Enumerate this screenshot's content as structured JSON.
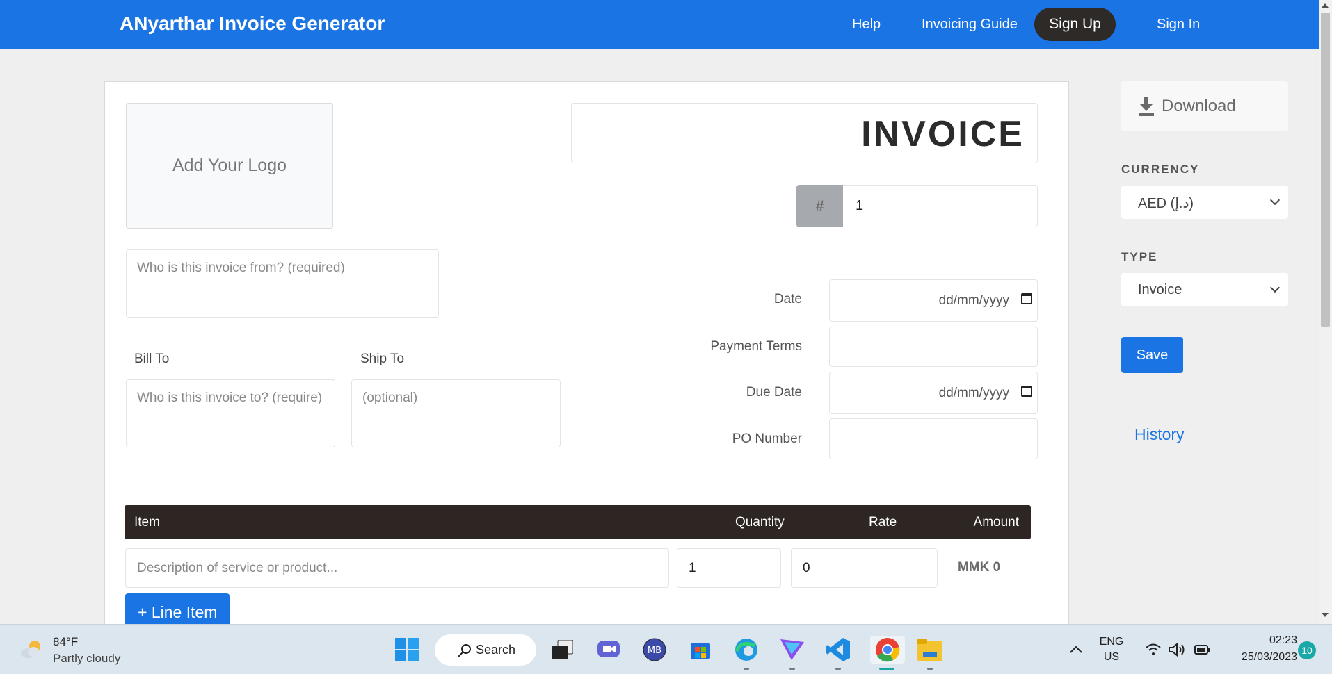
{
  "navbar": {
    "brand": "ANyarthar Invoice Generator",
    "help": "Help",
    "guide": "Invoicing Guide",
    "signup": "Sign Up",
    "signin": "Sign In",
    "color": "#1b74e4"
  },
  "invoice": {
    "logo_placeholder": "Add Your Logo",
    "from_placeholder": "Who is this invoice from? (required)",
    "bill_to_label": "Bill To",
    "ship_to_label": "Ship To",
    "to_placeholder": "Who is this invoice to? (require)",
    "ship_placeholder": "(optional)",
    "title": "INVOICE",
    "number_prefix": "#",
    "number": "1",
    "date_label": "Date",
    "date_placeholder": "dd/mm/yyyy",
    "terms_label": "Payment Terms",
    "due_label": "Due Date",
    "due_placeholder": "dd/mm/yyyy",
    "po_label": "PO Number"
  },
  "items": {
    "headers": {
      "item": "Item",
      "quantity": "Quantity",
      "rate": "Rate",
      "amount": "Amount"
    },
    "rows": [
      {
        "description_placeholder": "Description of service or product...",
        "quantity": "1",
        "rate": "0",
        "amount": "MMK 0"
      }
    ],
    "add_button": "+ Line Item"
  },
  "sidebar": {
    "download": "Download",
    "currency_label": "CURRENCY",
    "currency_value": "AED (د.إ)",
    "type_label": "TYPE",
    "type_value": "Invoice",
    "save": "Save",
    "history": "History"
  },
  "taskbar": {
    "weather_temp": "84°F",
    "weather_desc": "Partly cloudy",
    "search": "Search",
    "language_top": "ENG",
    "language_bottom": "US",
    "time": "02:23",
    "date": "25/03/2023",
    "notifications": "10"
  }
}
